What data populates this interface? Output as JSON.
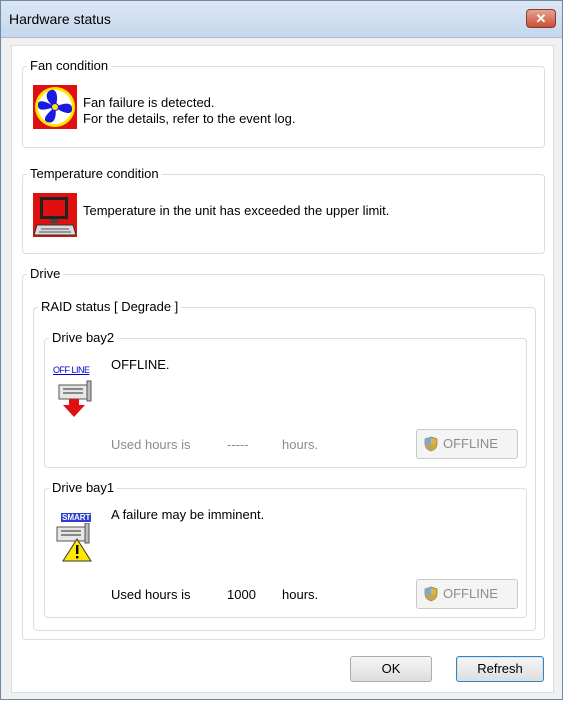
{
  "window": {
    "title": "Hardware status",
    "close_glyph": "✕"
  },
  "fan": {
    "label": "Fan condition",
    "message_line1": "Fan failure is detected.",
    "message_line2": "For the details, refer to the event log.",
    "icon": "fan-failure-icon"
  },
  "temperature": {
    "label": "Temperature condition",
    "message": "Temperature in the unit has exceeded the upper limit.",
    "icon": "temperature-warning-icon"
  },
  "drive": {
    "label": "Drive",
    "raid_label": "RAID status [ Degrade ]",
    "bays": [
      {
        "label": "Drive bay2",
        "status_text": "OFFLINE.",
        "badge_text": "OFF LINE",
        "used_prefix": "Used hours is",
        "used_value": "-----",
        "used_suffix": "hours.",
        "button_label": "OFFLINE",
        "enabled": false
      },
      {
        "label": "Drive bay1",
        "status_text": "A failure may be imminent.",
        "badge_text": "SMART",
        "used_prefix": "Used hours is",
        "used_value": "1000",
        "used_suffix": "hours.",
        "button_label": "OFFLINE",
        "enabled": true
      }
    ]
  },
  "buttons": {
    "ok": "OK",
    "refresh": "Refresh"
  },
  "colors": {
    "fan_bg": "#e01010",
    "fan_blade": "#1a1ae0",
    "warning_yellow": "#ffe800",
    "offline_arrow": "#e01010"
  }
}
